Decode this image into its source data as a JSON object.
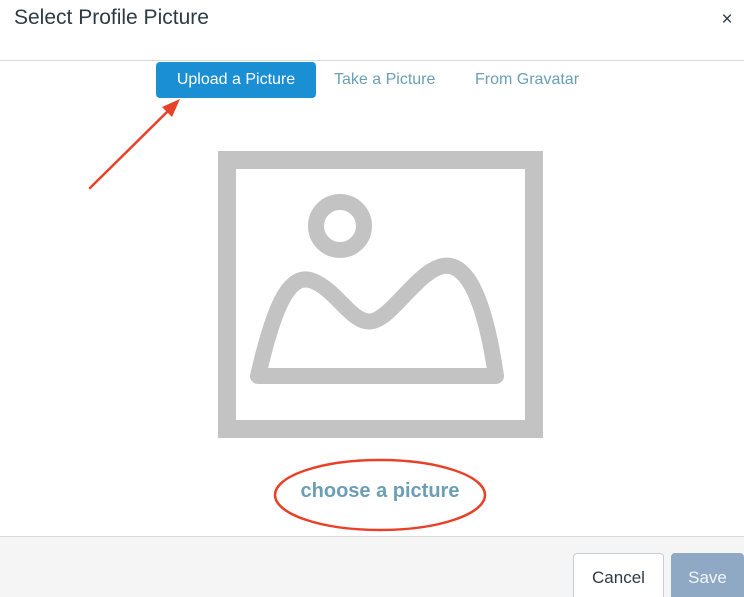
{
  "dialog": {
    "title": "Select Profile Picture",
    "close_label": "×"
  },
  "tabs": [
    {
      "label": "Upload a Picture",
      "active": true
    },
    {
      "label": "Take a Picture",
      "active": false
    },
    {
      "label": "From Gravatar",
      "active": false
    }
  ],
  "upload": {
    "choose_link": "choose a picture"
  },
  "footer": {
    "cancel_label": "Cancel",
    "save_label": "Save"
  },
  "colors": {
    "accent": "#1b8fd4",
    "link": "#6a9fb5",
    "annotation": "#e8412a",
    "placeholder": "#c3c3c3"
  }
}
